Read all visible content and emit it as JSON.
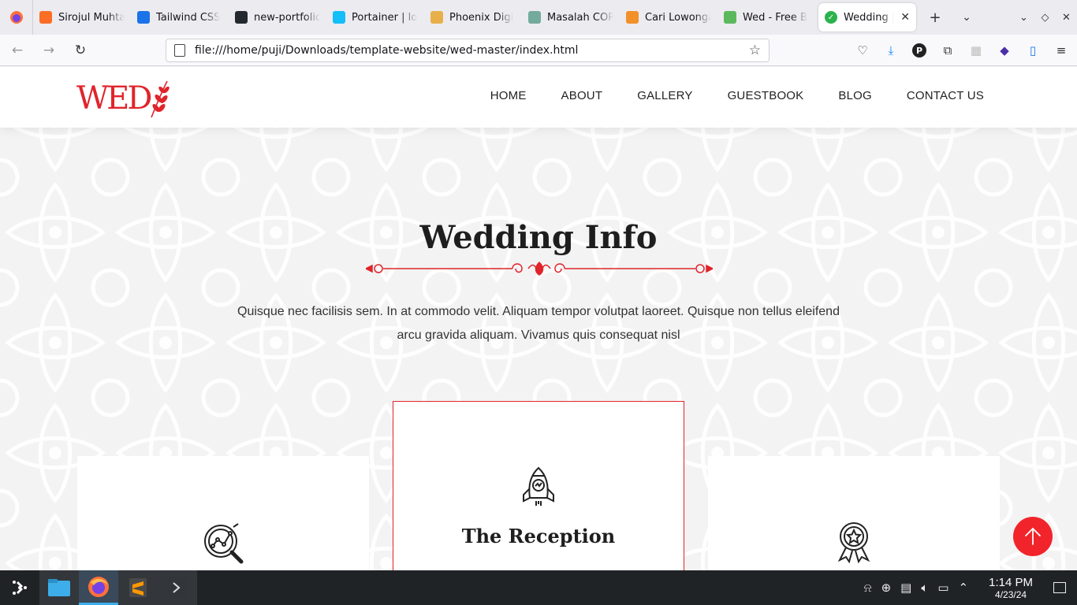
{
  "browser": {
    "tabs": [
      {
        "title": "Sirojul Muhta",
        "icon": "gitlab-icon",
        "color": "#fc6d26"
      },
      {
        "title": "Tailwind CSS",
        "icon": "play-icon",
        "color": "#1a73e8"
      },
      {
        "title": "new-portfolio",
        "icon": "github-icon",
        "color": "#24292f"
      },
      {
        "title": "Portainer | lo",
        "icon": "portainer-icon",
        "color": "#13bef9"
      },
      {
        "title": "Phoenix Digi",
        "icon": "phoenix-icon",
        "color": "#e8b04a"
      },
      {
        "title": "Masalah COR",
        "icon": "chatgpt-icon",
        "color": "#74aa9c"
      },
      {
        "title": "Cari Lowonga",
        "icon": "doc-icon",
        "color": "#f2912a"
      },
      {
        "title": "Wed - Free B",
        "icon": "leaf-icon",
        "color": "#5cb85c"
      }
    ],
    "active_tab": {
      "title": "Wedding |",
      "icon": "check-icon",
      "color": "#2bb24c"
    },
    "url": "file:///home/puji/Downloads/template-website/wed-master/index.html"
  },
  "site": {
    "logo_text": "WED",
    "menu": [
      "HOME",
      "ABOUT",
      "GALLERY",
      "GUESTBOOK",
      "BLOG",
      "CONTACT US"
    ],
    "section_title": "Wedding Info",
    "intro": "Quisque nec facilisis sem. In at commodo velit. Aliquam tempor volutpat laoreet. Quisque non tellus eleifend arcu gravida aliquam. Vivamus quis consequat nisl",
    "cards": [
      {
        "title": "",
        "icon": "magnifier-chart-icon"
      },
      {
        "title": "The Reception",
        "icon": "rocket-icon"
      },
      {
        "title": "",
        "icon": "award-badge-icon"
      }
    ],
    "accent_color": "#e0242b"
  },
  "taskbar": {
    "time": "1:14 PM",
    "date": "4/23/24"
  }
}
